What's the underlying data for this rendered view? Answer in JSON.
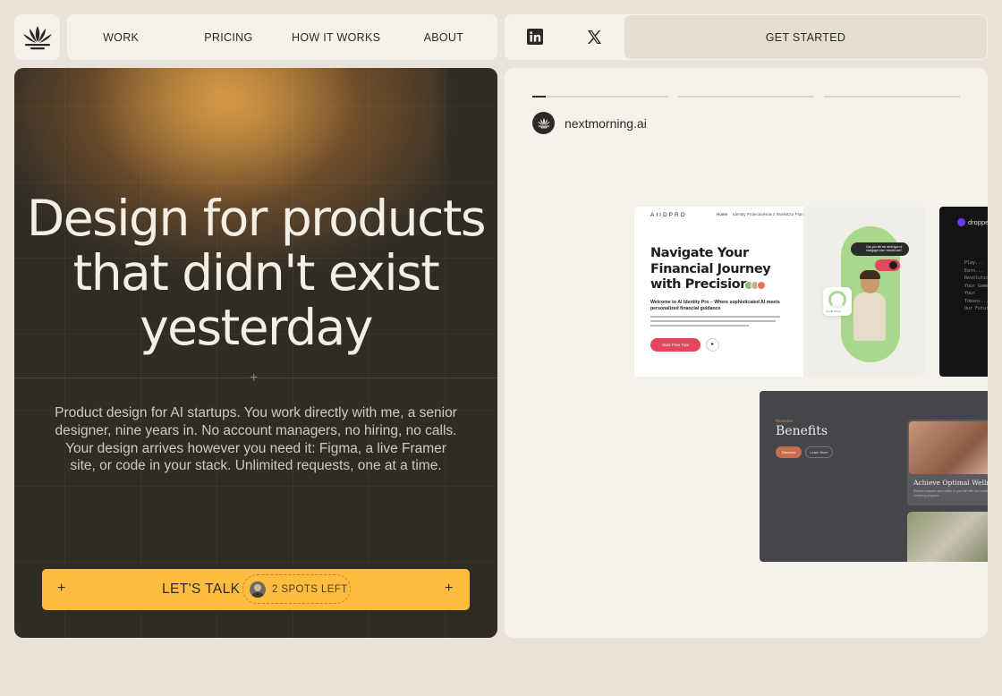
{
  "nav": {
    "items": [
      "WORK",
      "PRICING",
      "HOW IT WORKS",
      "ABOUT"
    ],
    "cta": "GET STARTED"
  },
  "hero": {
    "headline_line1": "Design for products",
    "headline_line2": "that didn't exist",
    "headline_line3": "yesterday",
    "description": "Product design for AI startups. You work directly with me, a senior designer, nine years in. No account managers, no hiring, no calls. Your design arrives however you need it: Figma, a live Framer site, or code in your stack. Unlimited requests, one at a time.",
    "talk_label": "LET'S TALK",
    "spots_label": "2 SPOTS LEFT"
  },
  "showcase": {
    "progress": [
      0.1,
      0,
      0
    ],
    "client": "nextmorning.ai",
    "shot1": {
      "brand": "AIIDPRO",
      "nav": [
        "Home",
        "Identity Protection",
        "How it Works",
        "Our Plans",
        "Stories",
        "Contact Us"
      ],
      "login": "Log in",
      "get_started": "Get started",
      "headline1": "Navigate Your",
      "headline2": "Financial Journey",
      "headline3": "with Precision",
      "sub": "Welcome to AI Identity Pro – Where sophisticated AI meets personalized financial guidance",
      "btn": "Start Free Trial",
      "bubble": "Can you tell me what type of mortgage loan I should use?",
      "score": "Credit Score"
    },
    "shot2": {
      "brand": "droppe",
      "lines": [
        "Play...",
        "Earn...",
        "Revolution...",
        "Your Game...",
        "Your Tokens...",
        "Our Future..."
      ]
    },
    "shot3": {
      "kicker": "Revitalize",
      "title": "Benefits",
      "btn1": "Discover",
      "btn2": "Learn More",
      "card_title": "Achieve Optimal Wellness",
      "card_text": "Restore balance and vitality to your life with our holistic health coaching program."
    }
  },
  "colors": {
    "accent": "#ffbd3f",
    "hero_bg": "#2f2c26",
    "page_bg": "#e8e2d9",
    "card_bg": "#f5f2ec"
  }
}
